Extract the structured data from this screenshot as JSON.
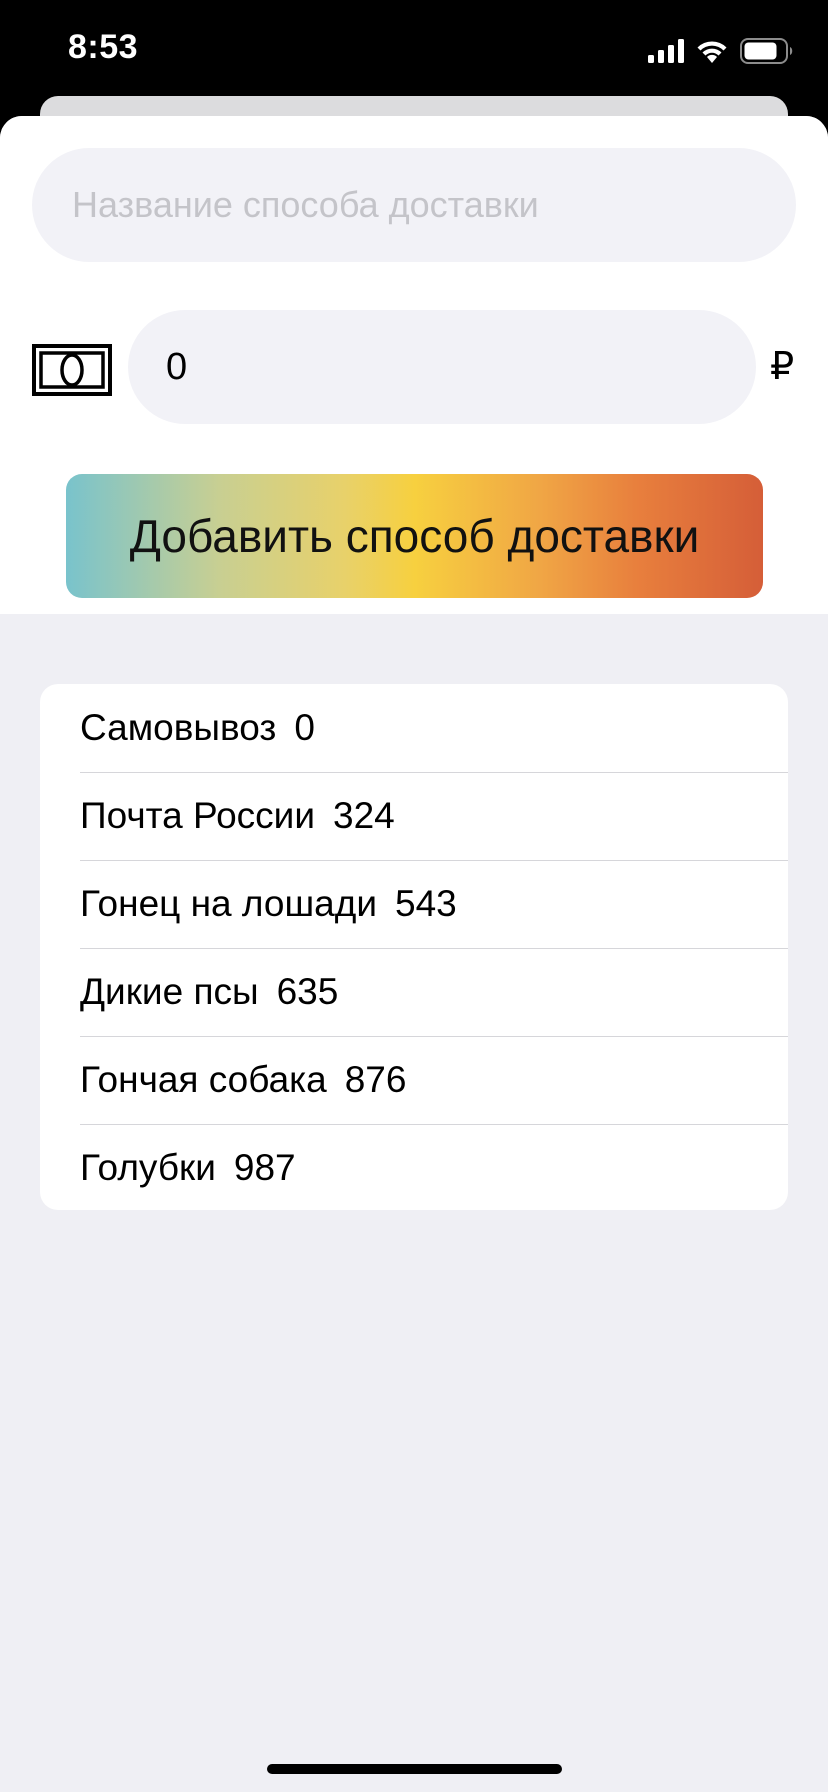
{
  "status_bar": {
    "time": "8:53",
    "icons": [
      "cellular-signal-icon",
      "wifi-icon",
      "battery-icon"
    ]
  },
  "form": {
    "name_placeholder": "Название способа доставки",
    "name_value": "",
    "price_value": "0",
    "currency_symbol": "₽",
    "money_icon": "banknote-icon",
    "add_button_label": "Добавить способ доставки"
  },
  "delivery_methods": [
    {
      "name": "Самовывоз",
      "price": "0"
    },
    {
      "name": "Почта России",
      "price": "324"
    },
    {
      "name": "Гонец на лошади",
      "price": "543"
    },
    {
      "name": "Дикие псы",
      "price": "635"
    },
    {
      "name": "Гончая собака",
      "price": "876"
    },
    {
      "name": "Голубки",
      "price": "987"
    }
  ],
  "colors": {
    "sheet_background": "#efeff4",
    "input_background": "#f2f2f7",
    "placeholder": "#c4c4c9",
    "button_gradient": [
      "#79c3cc",
      "#f7d03f",
      "#d55e38"
    ]
  }
}
